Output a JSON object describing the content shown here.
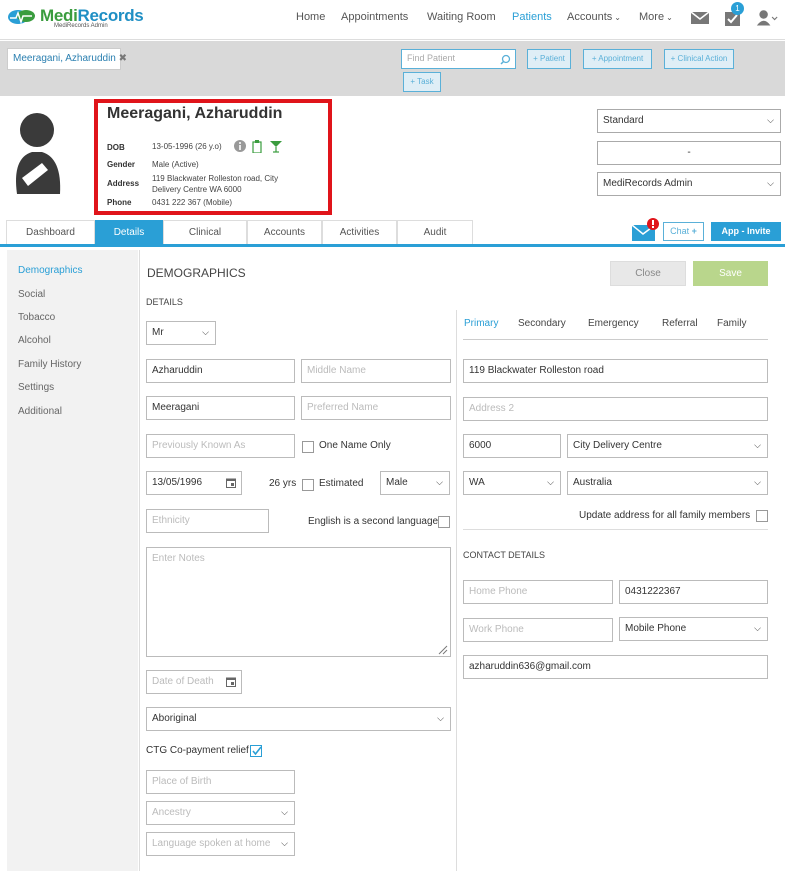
{
  "brand": {
    "name_medi": "Medi",
    "name_records": "Records",
    "subtitle": "MediRecords Admin"
  },
  "nav": {
    "items": [
      "Home",
      "Appointments",
      "Waiting Room",
      "Patients",
      "Accounts",
      "More"
    ],
    "active": "Patients",
    "notification_count": "1"
  },
  "tabbar": {
    "patient_chip": "Meeragani, Azharuddin",
    "find_placeholder": "Find Patient",
    "buttons": [
      "+ Patient",
      "+ Appointment",
      "+ Clinical Action",
      "+ Task"
    ]
  },
  "patient": {
    "name": "Meeragani, Azharuddin",
    "dob_label": "DOB",
    "dob": "13-05-1996 (26 y.o)",
    "gender_label": "Gender",
    "gender": "Male (Active)",
    "address_label": "Address",
    "address_line1": "119 Blackwater Rolleston road, City",
    "address_line2": "Delivery Centre WA 6000",
    "phone_label": "Phone",
    "phone": "0431 222 367 (Mobile)"
  },
  "right_selects": {
    "billing": "Standard",
    "middle": "-",
    "practice": "MediRecords Admin"
  },
  "tabs": [
    "Dashboard",
    "Details",
    "Clinical",
    "Accounts",
    "Activities",
    "Audit"
  ],
  "active_tab": "Details",
  "actions": {
    "chat": "Chat",
    "invite": "App - Invite"
  },
  "sidebar": [
    "Demographics",
    "Social",
    "Tobacco",
    "Alcohol",
    "Family History",
    "Settings",
    "Additional"
  ],
  "demographics": {
    "heading": "DEMOGRAPHICS",
    "details_heading": "DETAILS",
    "close": "Close",
    "save": "Save",
    "title": "Mr",
    "first_name": "Azharuddin",
    "middle_placeholder": "Middle Name",
    "last_name": "Meeragani",
    "preferred_placeholder": "Preferred Name",
    "prev_known_placeholder": "Previously Known As",
    "one_name_only": "One Name Only",
    "dob": "13/05/1996",
    "age": "26 yrs",
    "estimated": "Estimated",
    "gender": "Male",
    "ethnicity_placeholder": "Ethnicity",
    "esl": "English is a second language",
    "notes_placeholder": "Enter Notes",
    "dod_placeholder": "Date of Death",
    "indigenous": "Aboriginal",
    "ctg": "CTG Co-payment relief",
    "pob_placeholder": "Place of Birth",
    "ancestry_placeholder": "Ancestry",
    "language_placeholder": "Language spoken at home"
  },
  "address": {
    "subtabs": [
      "Primary",
      "Secondary",
      "Emergency",
      "Referral",
      "Family"
    ],
    "active": "Primary",
    "line1": "119 Blackwater Rolleston road",
    "line2_placeholder": "Address 2",
    "postcode": "6000",
    "suburb": "City Delivery Centre",
    "state": "WA",
    "country": "Australia",
    "update_family": "Update address for all family members"
  },
  "contact": {
    "heading": "CONTACT DETAILS",
    "home_placeholder": "Home Phone",
    "mobile": "0431222367",
    "work_placeholder": "Work Phone",
    "phone_type": "Mobile Phone",
    "email": "azharuddin636@gmail.com"
  }
}
